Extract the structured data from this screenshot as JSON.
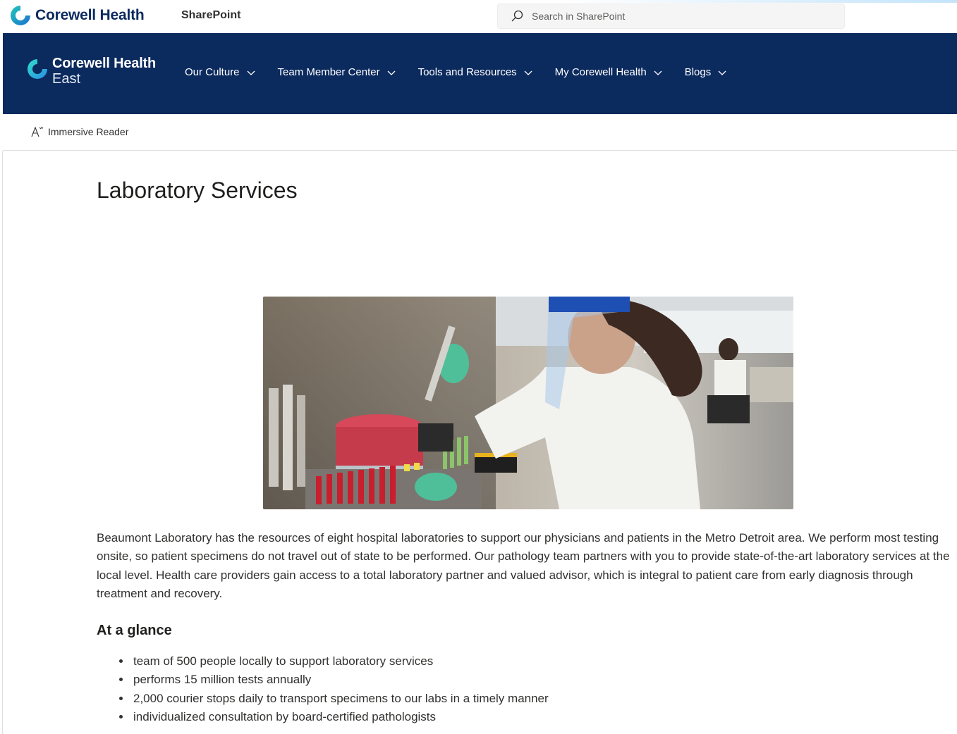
{
  "suite": {
    "brand_name": "Corewell Health",
    "app_name": "SharePoint",
    "search_placeholder": "Search in SharePoint"
  },
  "hub": {
    "brand_name": "Corewell Health",
    "brand_sub": "East",
    "nav": [
      {
        "label": "Our Culture",
        "icon": "chevron-down-icon"
      },
      {
        "label": "Team Member Center",
        "icon": "chevron-down-icon"
      },
      {
        "label": "Tools and Resources",
        "icon": "chevron-down-icon"
      },
      {
        "label": "My Corewell Health",
        "icon": "chevron-down-icon"
      },
      {
        "label": "Blogs",
        "icon": "chevron-down-icon"
      }
    ]
  },
  "commandbar": {
    "immersive_reader": "Immersive Reader"
  },
  "page": {
    "title": "Laboratory Services",
    "body": "Beaumont Laboratory has the resources of eight hospital laboratories to support our physicians and patients in the Metro Detroit area. We perform most testing onsite, so patient specimens do not travel out of state to be performed. Our pathology team partners with you to provide state-of-the-art laboratory services at the local level. Health care providers gain access to a total laboratory partner and valued advisor, which is integral to patient care from early diagnosis through treatment and recovery.",
    "glance_heading": "At a glance",
    "glance_items": [
      "team of 500 people locally to support laboratory services",
      "performs 15 million tests annually",
      "2,000 courier stops daily to transport specimens to our labs in a timely manner",
      "individualized consultation by board-certified pathologists"
    ]
  },
  "colors": {
    "hub_background": "#0b2a5e",
    "brand_teal": "#12b5b0",
    "text_primary": "#323130"
  }
}
